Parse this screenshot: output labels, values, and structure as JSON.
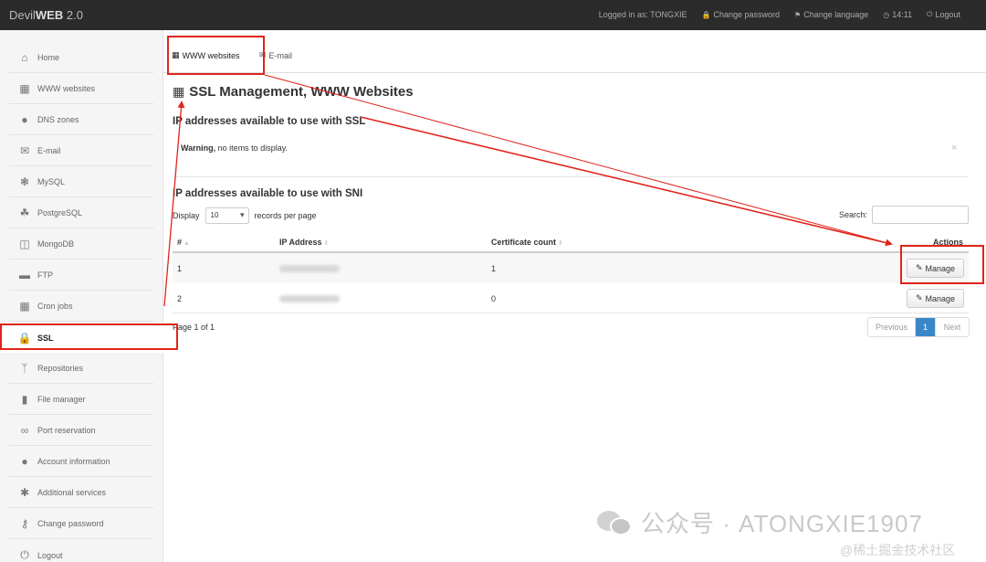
{
  "app": {
    "brand_prefix": "Devil",
    "brand_bold": "WEB",
    "brand_version": " 2.0"
  },
  "topnav": {
    "logged_in": "Logged in as: TONGXIE",
    "change_password": "Change password",
    "change_language": "Change language",
    "time": "14:11",
    "logout": "Logout"
  },
  "sidebar": {
    "items": [
      {
        "label": "Home",
        "icon": "home-icon"
      },
      {
        "label": "WWW websites",
        "icon": "grid-icon"
      },
      {
        "label": "DNS zones",
        "icon": "globe-icon"
      },
      {
        "label": "E-mail",
        "icon": "envelope-icon"
      },
      {
        "label": "MySQL",
        "icon": "dolphin-icon"
      },
      {
        "label": "PostgreSQL",
        "icon": "elephant-icon"
      },
      {
        "label": "MongoDB",
        "icon": "database-icon"
      },
      {
        "label": "FTP",
        "icon": "folder-icon"
      },
      {
        "label": "Cron jobs",
        "icon": "calendar-icon"
      },
      {
        "label": "SSL",
        "icon": "lock-icon",
        "active": true
      },
      {
        "label": "Repositories",
        "icon": "branch-icon"
      },
      {
        "label": "File manager",
        "icon": "folder-open-icon"
      },
      {
        "label": "Port reservation",
        "icon": "link-icon"
      },
      {
        "label": "Account information",
        "icon": "user-icon"
      },
      {
        "label": "Additional services",
        "icon": "asterisk-icon"
      },
      {
        "label": "Change password",
        "icon": "key-icon"
      },
      {
        "label": "Logout",
        "icon": "power-icon"
      }
    ]
  },
  "tabs": {
    "www": "WWW websites",
    "email": "E-mail"
  },
  "main": {
    "title": "SSL Management, WWW Websites",
    "ssl_heading": "IP addresses available to use with SSL",
    "warning_bold": "Warning,",
    "warning_text": " no items to display.",
    "sni_heading": "IP addresses available to use with SNI",
    "display_label": "Display",
    "display_value": "10",
    "records_label": "records per page",
    "search_label": "Search:",
    "columns": {
      "num": "#",
      "ip": "IP Address",
      "cert": "Certificate count",
      "actions": "Actions"
    },
    "rows": [
      {
        "num": "1",
        "cert": "1",
        "action": "Manage"
      },
      {
        "num": "2",
        "cert": "0",
        "action": "Manage"
      }
    ],
    "page_info": "Page 1 of 1",
    "pager": {
      "prev": "Previous",
      "current": "1",
      "next": "Next"
    }
  },
  "watermark": {
    "text": "公众号 · ATONGXIE1907",
    "site": "@稀土掘金技术社区"
  },
  "colors": {
    "topbar": "#2b2b2b",
    "annotation": "#e0241b",
    "pager_active": "#3a87c8"
  }
}
